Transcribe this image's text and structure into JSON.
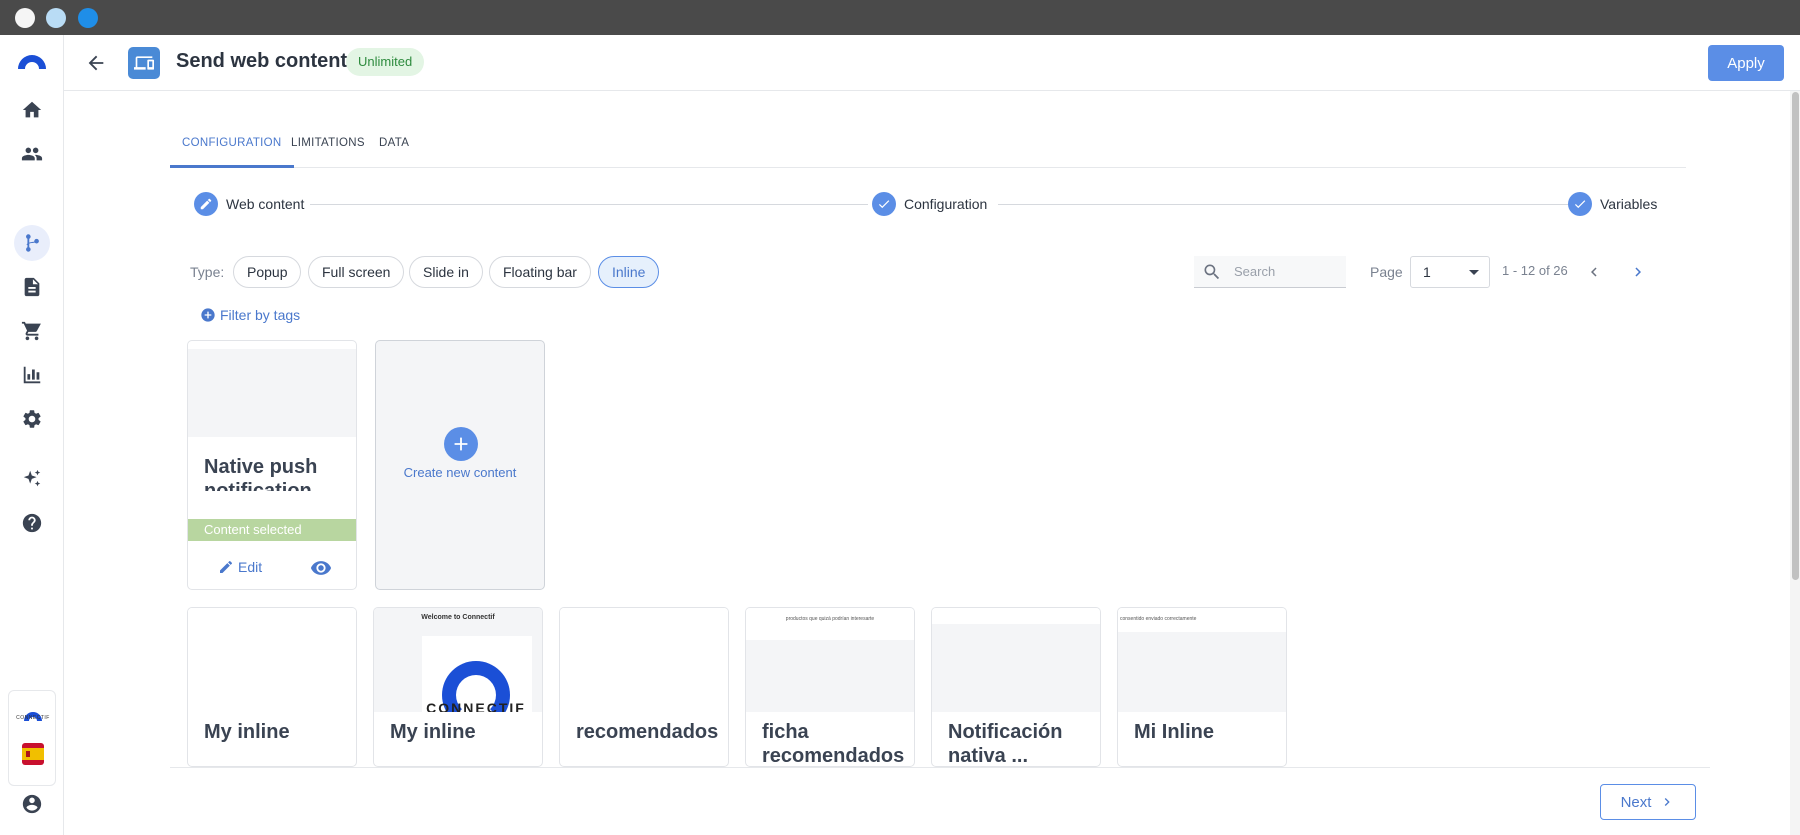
{
  "window": {
    "traffic_colors": [
      "#f5f5f5",
      "#b9dcf5",
      "#1f8ee8"
    ]
  },
  "sidebar": {
    "items": [
      {
        "icon": "home-icon"
      },
      {
        "icon": "people-icon"
      },
      {
        "icon": "workflow-icon",
        "active": true
      },
      {
        "icon": "document-icon"
      },
      {
        "icon": "cart-icon"
      },
      {
        "icon": "bar-chart-icon"
      },
      {
        "icon": "gear-icon"
      },
      {
        "icon": "sparkles-icon"
      },
      {
        "icon": "help-icon"
      }
    ],
    "brand_mini_text": "CONNECTIF",
    "language_flag": "es",
    "account_icon": "account-circle-icon"
  },
  "header": {
    "title": "Send web content",
    "badge": "Unlimited",
    "apply_label": "Apply"
  },
  "tabs": [
    {
      "label": "CONFIGURATION",
      "active": true
    },
    {
      "label": "LIMITATIONS"
    },
    {
      "label": "DATA"
    }
  ],
  "stepper": {
    "steps": [
      {
        "label": "Web content",
        "icon": "pencil-icon"
      },
      {
        "label": "Configuration",
        "icon": "check-icon"
      },
      {
        "label": "Variables",
        "icon": "check-icon"
      }
    ]
  },
  "filters": {
    "type_label": "Type:",
    "types": [
      {
        "label": "Popup"
      },
      {
        "label": "Full screen"
      },
      {
        "label": "Slide in"
      },
      {
        "label": "Floating bar"
      },
      {
        "label": "Inline",
        "active": true
      }
    ],
    "filter_tags_label": "Filter by tags",
    "search_placeholder": "Search",
    "page_label": "Page",
    "page_value": "1",
    "range_text": "1 - 12 of 26"
  },
  "cards": {
    "selected": {
      "title": "Native push notification",
      "status": "Content selected",
      "edit_label": "Edit"
    },
    "create_label": "Create new content",
    "row2": [
      {
        "title": "My inline",
        "preview_text": ""
      },
      {
        "title": "My inline",
        "preview_head": "Welcome to Connectif",
        "preview_word": "CONNECTIF"
      },
      {
        "title": "recomendados"
      },
      {
        "title": "ficha recomendados",
        "preview_text": "productos que quizá podrían interesarte"
      },
      {
        "title": "Notificación nativa ..."
      },
      {
        "title": "Mi Inline",
        "preview_text": "consentido enviado correctamente"
      }
    ]
  },
  "footer": {
    "next_label": "Next"
  },
  "colors": {
    "accent": "#5b8ee6",
    "selected": "#b8d6a0",
    "badge_bg": "#e3f5e4",
    "badge_text": "#2e8b3e"
  }
}
